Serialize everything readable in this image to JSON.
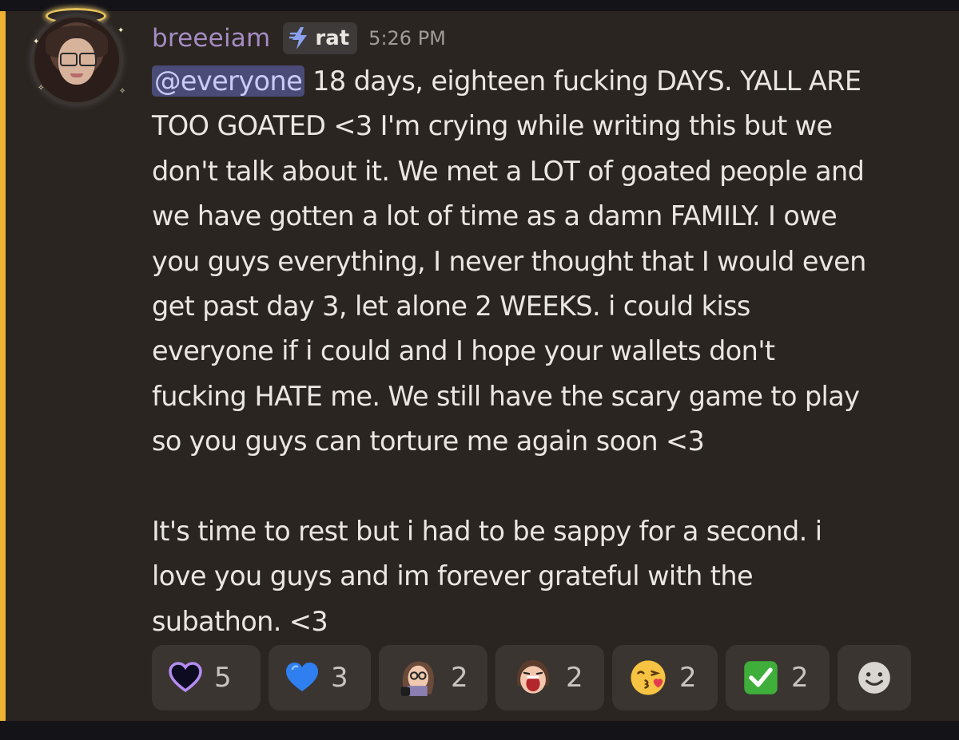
{
  "message": {
    "author": "breeeiam",
    "role_tag": "rat",
    "role_icon": "lightning-icon",
    "timestamp": "5:26 PM",
    "mention": "@everyone",
    "lines": [
      " 18 days, eighteen fucking DAYS. YALL ARE",
      "TOO GOATED <3 I'm crying while writing this but we",
      "don't talk about it. We met a LOT of goated people and",
      "we have gotten a lot of time as a damn FAMILY. I owe",
      "you guys everything, I never thought that I would even",
      "get past day 3, let alone 2 WEEKS. i could kiss",
      "everyone if i could and I hope your wallets don't",
      "fucking HATE me. We still have the scary game to play",
      "so you guys can torture me again soon <3"
    ],
    "lines2": [
      "It's time to rest but i had to be sappy for a second. i",
      "love you guys and im forever grateful with the",
      "subathon. <3"
    ]
  },
  "reactions": [
    {
      "icon": "purple-heart-outline-icon",
      "count": "5"
    },
    {
      "icon": "blue-heart-icon",
      "count": "3"
    },
    {
      "icon": "custom-girl-emote-icon",
      "count": "2"
    },
    {
      "icon": "custom-screaming-face-emote-icon",
      "count": "2"
    },
    {
      "icon": "kissing-face-emoji-icon",
      "count": "2"
    },
    {
      "icon": "check-mark-button-icon",
      "count": "2"
    }
  ],
  "add_reaction_icon": "smiley-add-reaction-icon",
  "colors": {
    "background": "#2a2520",
    "mention_highlight": "#f0b232",
    "username": "#a58cc4",
    "mention_bg": "#4a4b76",
    "reaction_bg": "#3a3531"
  }
}
